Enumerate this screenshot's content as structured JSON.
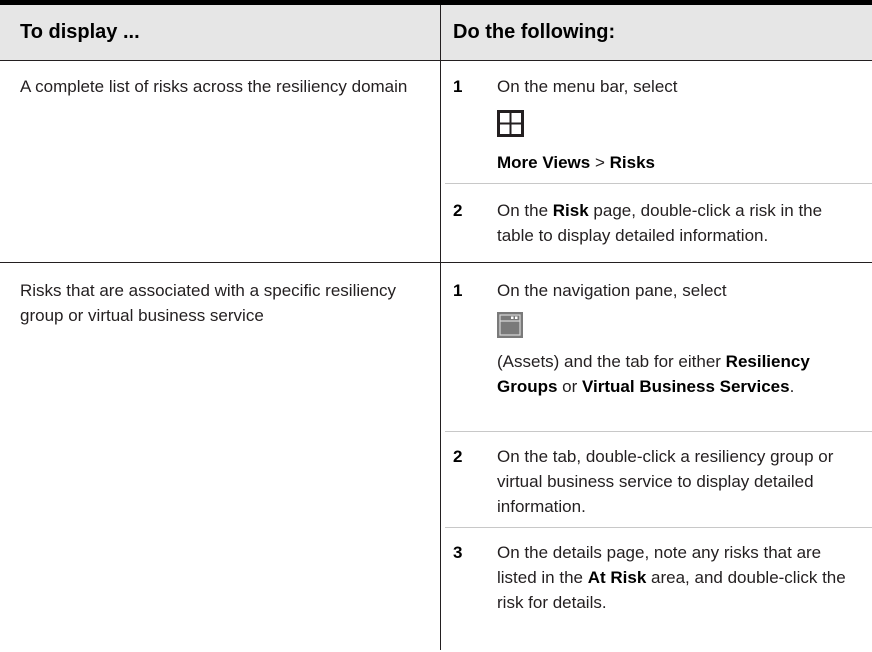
{
  "header": {
    "col1": "To display ...",
    "col2": "Do the following:"
  },
  "rows": [
    {
      "display": "A complete list of risks across the resiliency domain",
      "steps": [
        {
          "num": "1",
          "line1": "On the menu bar, select",
          "icon": "grid-icon",
          "path_a": "More Views",
          "path_sep": " > ",
          "path_b": "Risks"
        },
        {
          "num": "2",
          "pre": "On the ",
          "bold": "Risk",
          "post": " page, double-click a risk in the table to display detailed information."
        }
      ]
    },
    {
      "display": "Risks that are associated with a specific resiliency group or virtual business service",
      "steps": [
        {
          "num": "1",
          "line1": "On the navigation pane, select",
          "icon": "assets-panel-icon",
          "pre": "(Assets) and the tab for either ",
          "bold_a": "Resiliency Groups",
          "mid": " or ",
          "bold_b": "Virtual Business Services",
          "post": "."
        },
        {
          "num": "2",
          "text": "On the tab, double-click a resiliency group or virtual business service to display detailed information."
        },
        {
          "num": "3",
          "pre": "On the details page, note any risks that are listed in the ",
          "bold": "At Risk",
          "post": " area, and double-click the risk for details."
        }
      ]
    }
  ],
  "colors": {
    "header_bg": "#e6e6e6",
    "rule": "#000000",
    "icon_gray": "#7a7a7a"
  }
}
